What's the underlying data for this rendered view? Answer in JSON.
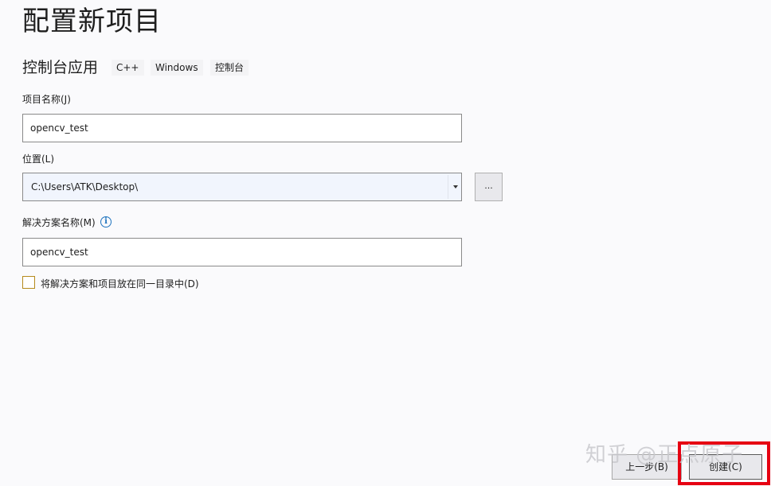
{
  "page": {
    "title": "配置新项目"
  },
  "template": {
    "name": "控制台应用",
    "tags": [
      "C++",
      "Windows",
      "控制台"
    ]
  },
  "project_name": {
    "label": "项目名称(J)",
    "value": "opencv_test"
  },
  "location": {
    "label": "位置(L)",
    "value": "C:\\Users\\ATK\\Desktop\\",
    "browse_label": "..."
  },
  "solution_name": {
    "label": "解决方案名称(M)",
    "info_icon": "i",
    "value": "opencv_test"
  },
  "same_directory": {
    "label": "将解决方案和项目放在同一目录中(D)",
    "checked": false
  },
  "footer": {
    "back_label": "上一步(B)",
    "create_label": "创建(C)"
  },
  "watermark": {
    "text": "知乎 @正点原子"
  },
  "colors": {
    "highlight": "#e60012",
    "info": "#1e73be",
    "checkbox_border": "#b58a1c"
  },
  "icons": {
    "dropdown": "chevron-down-icon",
    "info": "info-icon"
  }
}
